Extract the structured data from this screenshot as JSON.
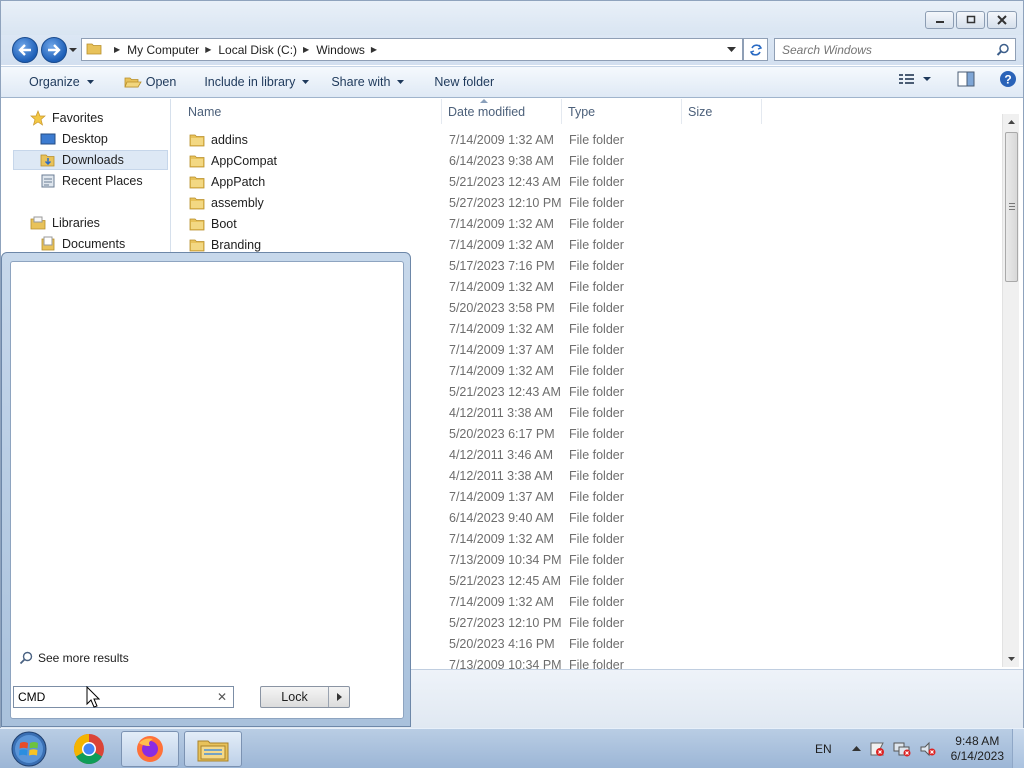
{
  "window": {
    "title": "",
    "controls": {
      "minimize": "minimize",
      "restore": "restore",
      "close": "close"
    }
  },
  "address_bar": {
    "crumbs": [
      "My Computer",
      "Local Disk (C:)",
      "Windows"
    ],
    "search_placeholder": "Search Windows"
  },
  "toolbar": {
    "organize": "Organize",
    "open": "Open",
    "include_in_library": "Include in library",
    "share_with": "Share with",
    "new_folder": "New folder"
  },
  "nav_pane": {
    "favorites": "Favorites",
    "desktop": "Desktop",
    "downloads": "Downloads",
    "recent_places": "Recent Places",
    "libraries": "Libraries",
    "documents": "Documents"
  },
  "columns": {
    "name": "Name",
    "date_modified": "Date modified",
    "type": "Type",
    "size": "Size"
  },
  "files": [
    {
      "name": "addins",
      "date": "7/14/2009 1:32 AM",
      "type": "File folder"
    },
    {
      "name": "AppCompat",
      "date": "6/14/2023 9:38 AM",
      "type": "File folder"
    },
    {
      "name": "AppPatch",
      "date": "5/21/2023 12:43 AM",
      "type": "File folder"
    },
    {
      "name": "assembly",
      "date": "5/27/2023 12:10 PM",
      "type": "File folder"
    },
    {
      "name": "Boot",
      "date": "7/14/2009 1:32 AM",
      "type": "File folder"
    },
    {
      "name": "Branding",
      "date": "7/14/2009 1:32 AM",
      "type": "File folder"
    },
    {
      "name": "",
      "date": "5/17/2023 7:16 PM",
      "type": "File folder"
    },
    {
      "name": "",
      "date": "7/14/2009 1:32 AM",
      "type": "File folder"
    },
    {
      "name": "",
      "date": "5/20/2023 3:58 PM",
      "type": "File folder"
    },
    {
      "name": "",
      "date": "7/14/2009 1:32 AM",
      "type": "File folder"
    },
    {
      "name": "",
      "date": "7/14/2009 1:37 AM",
      "type": "File folder"
    },
    {
      "name": "",
      "date": "7/14/2009 1:32 AM",
      "type": "File folder"
    },
    {
      "name": "",
      "date": "5/21/2023 12:43 AM",
      "type": "File folder"
    },
    {
      "name": "",
      "date": "4/12/2011 3:38 AM",
      "type": "File folder"
    },
    {
      "name": "",
      "date": "5/20/2023 6:17 PM",
      "type": "File folder"
    },
    {
      "name": "",
      "date": "4/12/2011 3:46 AM",
      "type": "File folder"
    },
    {
      "name": "",
      "date": "4/12/2011 3:38 AM",
      "type": "File folder"
    },
    {
      "name": "",
      "date": "7/14/2009 1:37 AM",
      "type": "File folder"
    },
    {
      "name": "",
      "date": "6/14/2023 9:40 AM",
      "type": "File folder"
    },
    {
      "name": "",
      "date": "7/14/2009 1:32 AM",
      "type": "File folder"
    },
    {
      "name": "",
      "date": "7/13/2009 10:34 PM",
      "type": "File folder"
    },
    {
      "name": "",
      "date": "5/21/2023 12:45 AM",
      "type": "File folder"
    },
    {
      "name": "",
      "date": "7/14/2009 1:32 AM",
      "type": "File folder"
    },
    {
      "name": "",
      "date": "5/27/2023 12:10 PM",
      "type": "File folder"
    },
    {
      "name": "",
      "date": "5/20/2023 4:16 PM",
      "type": "File folder"
    },
    {
      "name": "",
      "date": "7/13/2009 10:34 PM",
      "type": "File folder"
    }
  ],
  "start_menu": {
    "see_more_results": "See more results",
    "search_value": "CMD",
    "lock_label": "Lock"
  },
  "taskbar": {
    "apps": [
      "start-orb",
      "chrome",
      "firefox",
      "file-explorer"
    ],
    "language": "EN",
    "time": "9:48 AM",
    "date": "6/14/2023"
  },
  "colors": {
    "accent": "#1d5fb8",
    "folder": "#e8c25a",
    "taskbar": "#b9cde4"
  }
}
